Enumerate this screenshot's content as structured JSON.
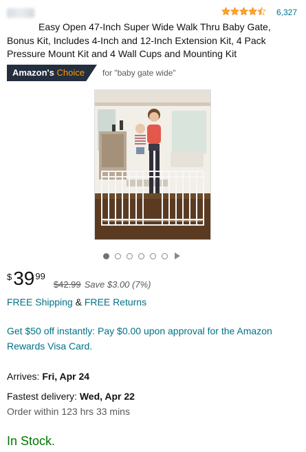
{
  "rating": {
    "stars": 4.5,
    "review_count": "6,327"
  },
  "product": {
    "title": "Easy Open 47-Inch Super Wide Walk Thru Baby Gate, Bonus Kit, Includes 4-Inch and 12-Inch Extension Kit, 4 Pack Pressure Mount Kit and 4 Wall Cups and Mounting Kit"
  },
  "badge": {
    "label_part1": "Amazon's",
    "label_part2": "Choice",
    "for_text": "for \"baby gate wide\""
  },
  "carousel": {
    "count": 6,
    "active_index": 0
  },
  "price": {
    "symbol": "$",
    "whole": "39",
    "fraction": "99",
    "list_price": "$42.99",
    "savings": "Save $3.00 (7%)"
  },
  "shipping": {
    "free_shipping": "FREE Shipping",
    "ampersand": "&",
    "free_returns": "FREE Returns"
  },
  "offer": {
    "text": "Get $50 off instantly: Pay $0.00 upon approval for the Amazon Rewards Visa Card."
  },
  "delivery": {
    "arrives_label": "Arrives:",
    "arrives_date": "Fri, Apr 24",
    "fastest_label": "Fastest delivery:",
    "fastest_date": "Wed, Apr 22",
    "order_within": "Order within 123 hrs 33 mins"
  },
  "stock": {
    "status": "In Stock."
  },
  "colors": {
    "link": "#007185",
    "star": "#ffa41c",
    "stock": "#007600",
    "badge_bg": "#232f3e",
    "badge_accent": "#ff9900"
  }
}
